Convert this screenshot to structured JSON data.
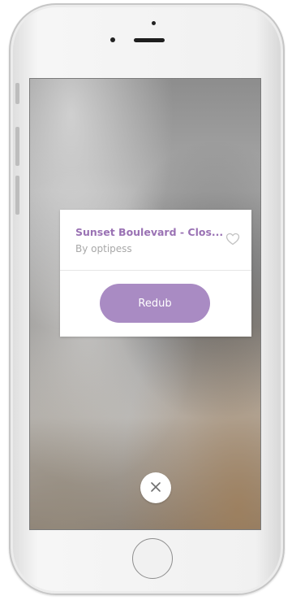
{
  "card": {
    "title": "Sunset Boulevard - Clos...",
    "author": "By optipess",
    "redub_label": "Redub",
    "heart_icon": "heart-outline-icon"
  },
  "close_icon": "close-icon",
  "colors": {
    "accent": "#a98bc3",
    "title": "#9a72b4",
    "muted_text": "#a8a8a8"
  }
}
